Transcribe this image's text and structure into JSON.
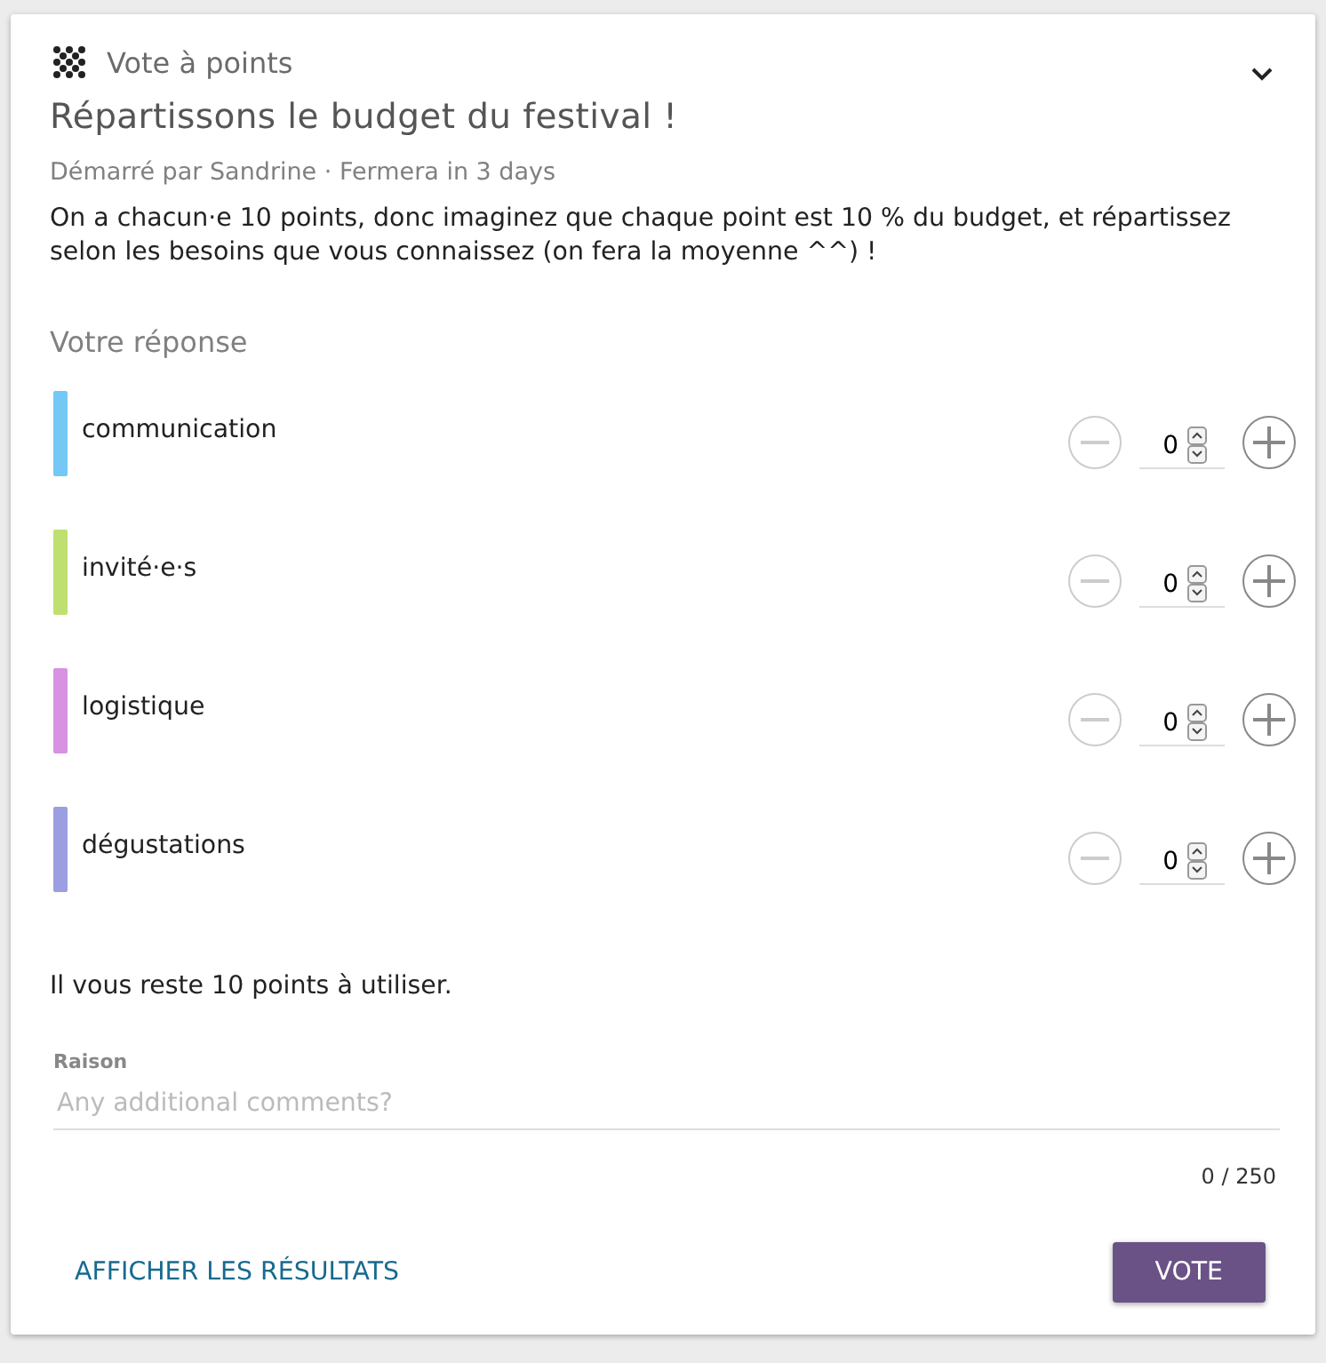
{
  "poll_type": "Vote à points",
  "title": "Répartissons le budget du festival !",
  "meta": "Démarré par Sandrine · Fermera in 3 days",
  "description": "On a chacun·e 10 points, donc imaginez que chaque point est 10 % du budget, et répartissez selon les besoins que vous connaissez (on fera la moyenne ^^) !",
  "response_heading": "Votre réponse",
  "options": [
    {
      "label": "communication",
      "color": "#74c8f5",
      "value": "0",
      "minus_disabled": true
    },
    {
      "label": "invité·e·s",
      "color": "#bfe070",
      "value": "0",
      "minus_disabled": true
    },
    {
      "label": "logistique",
      "color": "#d792e3",
      "value": "0",
      "minus_disabled": true
    },
    {
      "label": "dégustations",
      "color": "#9b9ee0",
      "value": "0",
      "minus_disabled": true
    }
  ],
  "remaining": "Il vous reste 10 points à utiliser.",
  "reason": {
    "label": "Raison",
    "placeholder": "Any additional comments?",
    "counter": "0 / 250"
  },
  "buttons": {
    "results": "AFFICHER LES RÉSULTATS",
    "vote": "VOTE"
  }
}
